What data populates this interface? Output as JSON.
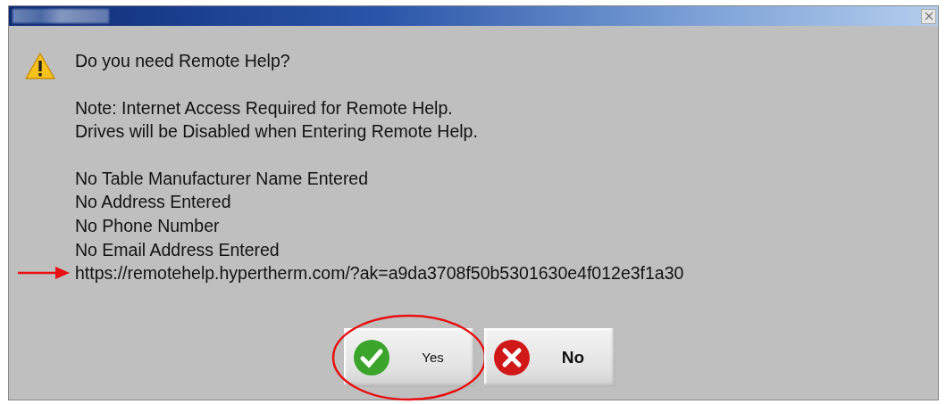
{
  "message": {
    "question": "Do you need Remote Help?",
    "notes": [
      "Note: Internet Access Required for Remote Help.",
      "Drives will be Disabled when Entering Remote Help."
    ],
    "details": [
      "No Table Manufacturer Name Entered",
      "No Address Entered",
      "No Phone Number",
      "No Email Address Entered"
    ],
    "url": "https://remotehelp.hypertherm.com/?ak=a9da3708f50b5301630e4f012e3f1a30",
    "url_arrowed": true
  },
  "buttons": [
    {
      "kind": "confirm",
      "label": "Yes",
      "circled": true
    },
    {
      "kind": "cancel",
      "label": "No",
      "circled": false
    }
  ]
}
